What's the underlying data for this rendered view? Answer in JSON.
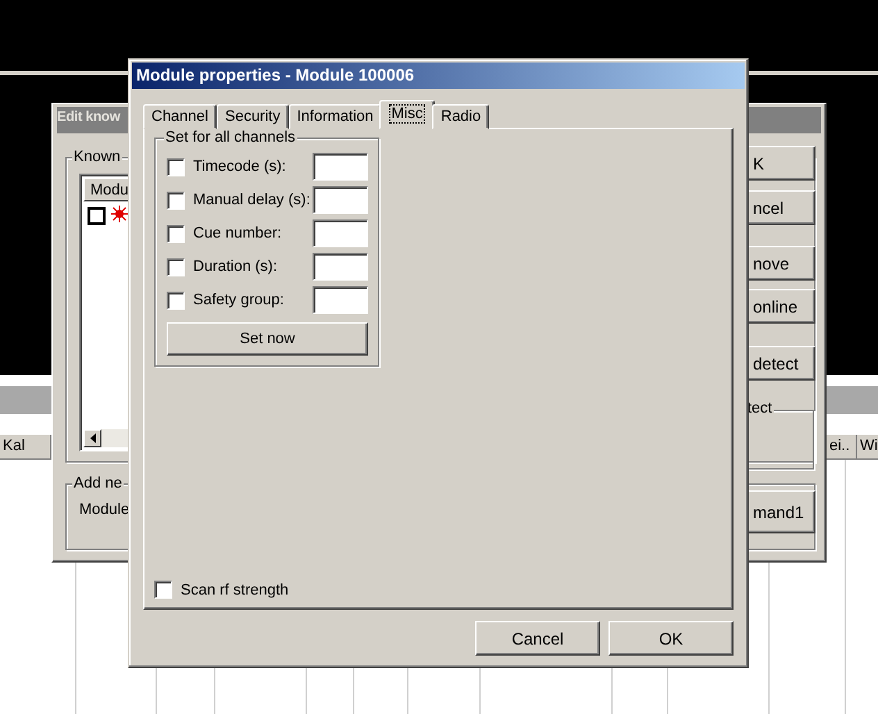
{
  "background": {
    "columns": [
      {
        "label": "Kal"
      },
      {
        "label": "ei.."
      },
      {
        "label": "Wi"
      }
    ]
  },
  "back_window": {
    "title": "Edit know",
    "group": "Known",
    "list_column": "Modu",
    "rows": [
      {
        "checked": false
      }
    ],
    "add_group": "Add ne",
    "add_label": "Module",
    "buttons": [
      "K",
      "ncel",
      "nove",
      "online",
      "detect"
    ],
    "detect_group": "tect",
    "command_button": "mand1"
  },
  "dialog": {
    "title": "Module properties - Module 100006",
    "tabs": [
      {
        "label": "Channel",
        "selected": false
      },
      {
        "label": "Security",
        "selected": false
      },
      {
        "label": "Information",
        "selected": false
      },
      {
        "label": "Misc",
        "selected": true
      },
      {
        "label": "Radio",
        "selected": false
      }
    ],
    "group_title": "Set for all channels",
    "rows": [
      {
        "label": "Timecode (s):",
        "checked": false
      },
      {
        "label": "Manual delay (s):",
        "checked": false
      },
      {
        "label": "Cue number:",
        "checked": false
      },
      {
        "label": "Duration (s):",
        "checked": false
      },
      {
        "label": "Safety group:",
        "checked": false
      }
    ],
    "set_button": "Set now",
    "scan": {
      "label": "Scan rf strength",
      "checked": false
    },
    "buttons": [
      "Cancel",
      "OK"
    ]
  }
}
